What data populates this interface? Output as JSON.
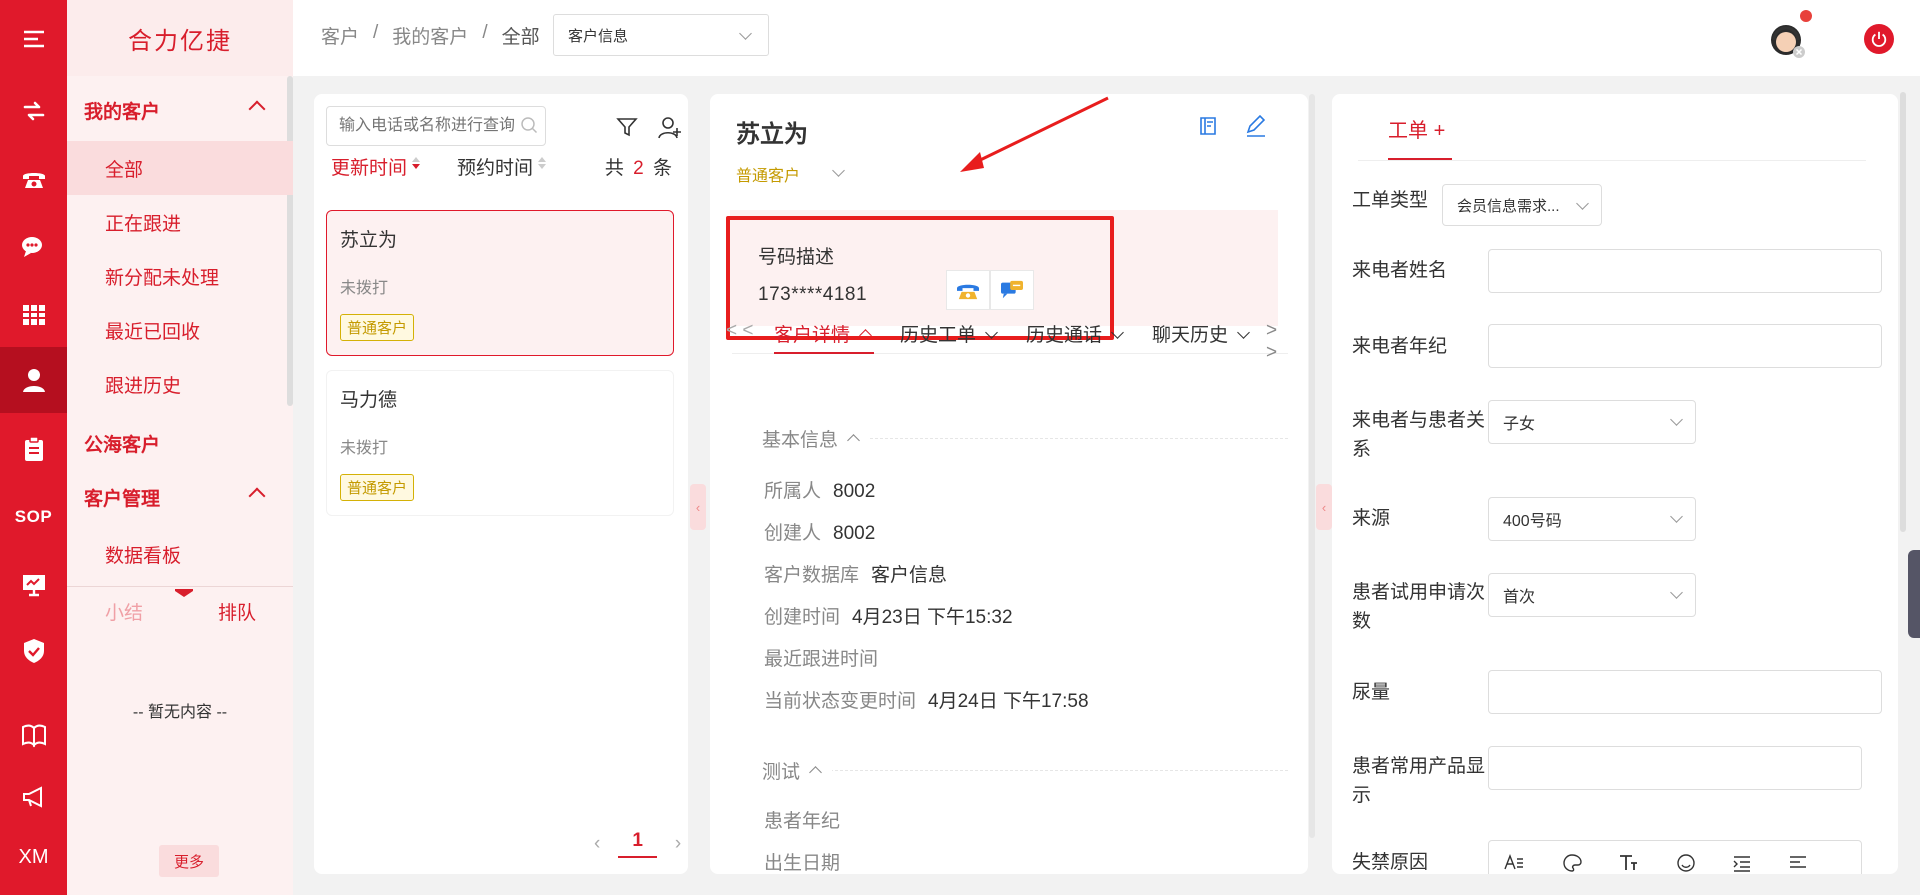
{
  "rail": {
    "bottom_label": "XM",
    "sop_label": "SOP",
    "icons": [
      "menu-icon",
      "transfer-icon",
      "phone-icon",
      "chat-icon",
      "grid-icon",
      "user-icon",
      "clipboard-icon",
      "sop-icon",
      "monitor-icon",
      "shield-icon",
      "book-icon",
      "megaphone-icon"
    ]
  },
  "sidebar": {
    "brand": "合力亿捷",
    "group_my": "我的客户",
    "items_my": [
      "全部",
      "正在跟进",
      "新分配未处理",
      "最近已回收",
      "跟进历史"
    ],
    "group_public": "公海客户",
    "group_manage": "客户管理",
    "items_manage": [
      "数据看板"
    ],
    "tab_summary": "小结",
    "tab_queue": "排队",
    "empty": "-- 暂无内容 --",
    "more": "更多"
  },
  "header": {
    "breadcrumb": [
      "客户",
      "我的客户",
      "全部"
    ],
    "sep": "/",
    "select_value": "客户信息"
  },
  "list": {
    "search_placeholder": "输入电话或名称进行查询",
    "sort_update": "更新时间",
    "sort_appointment": "预约时间",
    "total_prefix": "共",
    "total_count": "2",
    "total_suffix": "条",
    "customers": [
      {
        "name": "苏立为",
        "status": "未拨打",
        "tag": "普通客户"
      },
      {
        "name": "马力德",
        "status": "未拨打",
        "tag": "普通客户"
      }
    ],
    "page": "1"
  },
  "detail": {
    "name": "苏立为",
    "type": "普通客户",
    "number_label": "号码描述",
    "number_value": "173****4181",
    "tabs_prev": "< <",
    "tabs_next": "> >",
    "tabs": [
      "客户详情",
      "历史工单",
      "历史通话",
      "聊天历史"
    ],
    "section_basic": "基本信息",
    "fields": [
      {
        "label": "所属人",
        "value": "8002"
      },
      {
        "label": "创建人",
        "value": "8002"
      },
      {
        "label": "客户数据库",
        "value": "客户信息"
      },
      {
        "label": "创建时间",
        "value": "4月23日 下午15:32"
      },
      {
        "label": "最近跟进时间",
        "value": ""
      },
      {
        "label": "当前状态变更时间",
        "value": "4月24日 下午17:58"
      }
    ],
    "section_test": "测试",
    "test_fields": [
      "患者年纪",
      "出生日期"
    ]
  },
  "workorder": {
    "tab": "工单",
    "tab_plus": "+",
    "type_label": "工单类型",
    "type_value": "会员信息需求...",
    "caller_name": "来电者姓名",
    "caller_age": "来电者年纪",
    "relation_label": "来电者与患者关系",
    "relation_value": "子女",
    "source_label": "来源",
    "source_value": "400号码",
    "trial_label": "患者试用申请次数",
    "trial_value": "首次",
    "urine_label": "尿量",
    "products_label": "患者常用产品显示",
    "cause_label": "失禁原因"
  },
  "colors": {
    "brand": "#e0192b",
    "highlight": "#e81d1d",
    "tag": "#c49a00",
    "link": "#2a7ae2"
  }
}
